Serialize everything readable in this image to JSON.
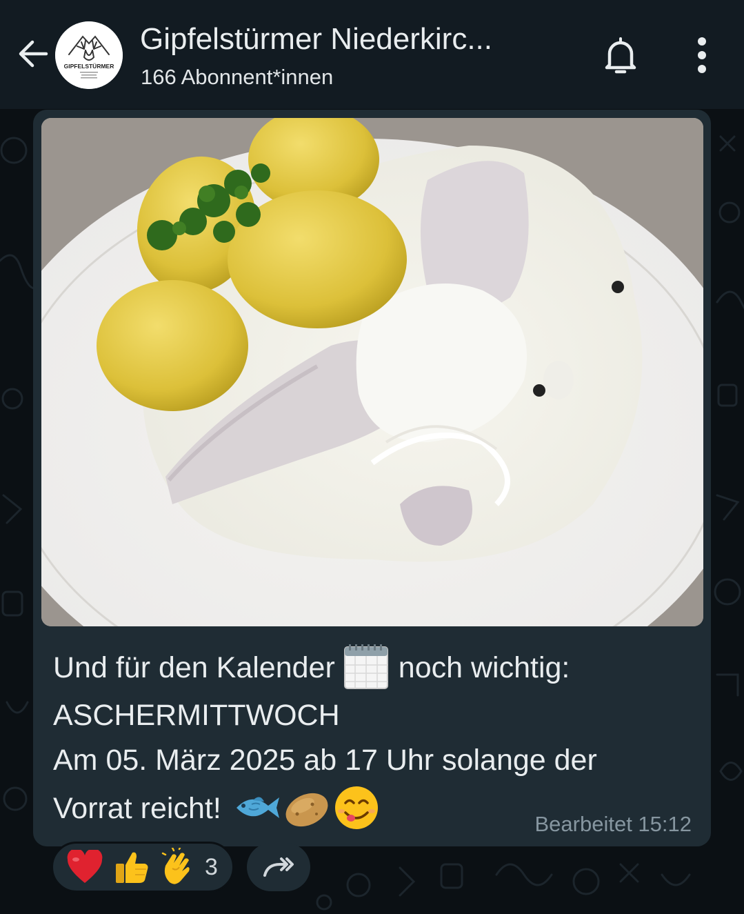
{
  "header": {
    "title": "Gipfelstürmer Niederkirc...",
    "subtitle": "166 Abonnent*innen",
    "avatar_text": "GIPFELSTÜRMER",
    "icons": {
      "back": "arrow-left-icon",
      "bell": "bell-icon",
      "menu": "more-vertical-icon"
    }
  },
  "message": {
    "image": "photo of potatoes, herring fillets in cream sauce and parsley on a white plate",
    "caption": {
      "line1_before": "Und für den Kalender",
      "line1_emoji": "calendar-emoji",
      "line1_after": "noch wichtig:",
      "line2": "ASCHERMITTWOCH",
      "line3": "Am 05. März 2025 ab 17 Uhr solange der",
      "line4": "Vorrat reicht!",
      "line4_emojis": [
        "fish-emoji",
        "potato-emoji",
        "smiling-face-emoji"
      ]
    },
    "meta": "Bearbeitet 15:12"
  },
  "reactions": {
    "items": [
      "heart-emoji",
      "thumbs-up-emoji",
      "clapping-hands-emoji"
    ],
    "count": "3"
  },
  "colors": {
    "background": "#0b1014",
    "header": "#121b22",
    "bubble": "#1f2c34",
    "text": "#e9edef",
    "meta": "#8696a0"
  }
}
